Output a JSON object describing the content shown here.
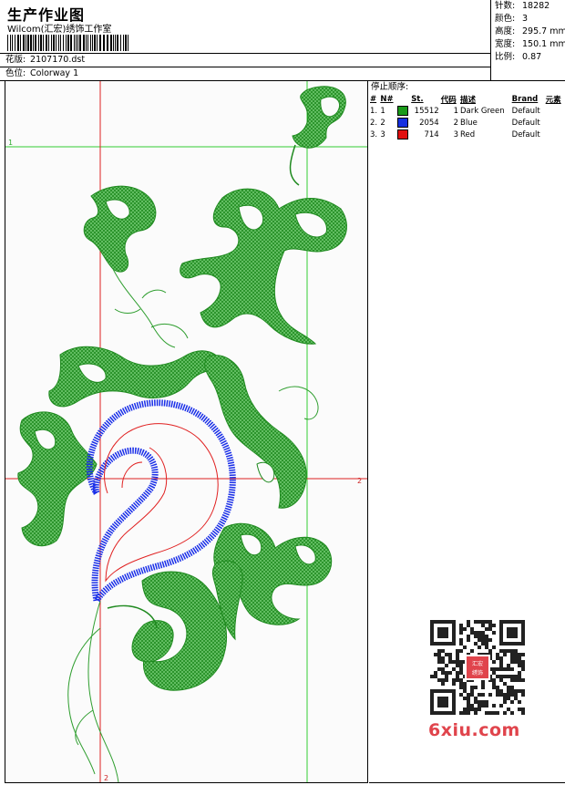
{
  "header": {
    "title": "生产作业图",
    "company": "Wilcom(汇宏)绣饰工作室",
    "design_label": "花版:",
    "design_value": "2107170.dst",
    "colorway_label": "色位:",
    "colorway_value": "Colorway 1"
  },
  "stats": [
    {
      "label": "针数:",
      "value": "18282"
    },
    {
      "label": "颜色:",
      "value": "3"
    },
    {
      "label": "高度:",
      "value": "295.7 mm"
    },
    {
      "label": "宽度:",
      "value": "150.1 mm"
    },
    {
      "label": "比例:",
      "value": "0.87"
    }
  ],
  "sequence": {
    "title": "停止顺序:",
    "columns": [
      "#",
      "N#",
      "St.",
      "代码",
      "描述",
      "Brand",
      "元素"
    ],
    "rows": [
      {
        "idx": "1.",
        "n": "1",
        "st": "15512",
        "code": "1",
        "desc": "Dark Green",
        "brand": "Default",
        "color": "#1a9a1a"
      },
      {
        "idx": "2.",
        "n": "2",
        "st": "2054",
        "code": "2",
        "desc": "Blue",
        "brand": "Default",
        "color": "#1530e0"
      },
      {
        "idx": "3.",
        "n": "3",
        "st": "714",
        "code": "3",
        "desc": "Red",
        "brand": "Default",
        "color": "#e01010"
      }
    ]
  },
  "guides": {
    "green_h_label": "1",
    "red_h_label": "2",
    "red_v_label": "2"
  },
  "colors": {
    "green": "#2f9e2f",
    "blue": "#1a2fe8",
    "red": "#e02020",
    "guide_green": "#33cc33",
    "guide_red": "#dd2222"
  },
  "watermark": {
    "site": "6xiu.com",
    "seal": "汇宏绣饰"
  }
}
